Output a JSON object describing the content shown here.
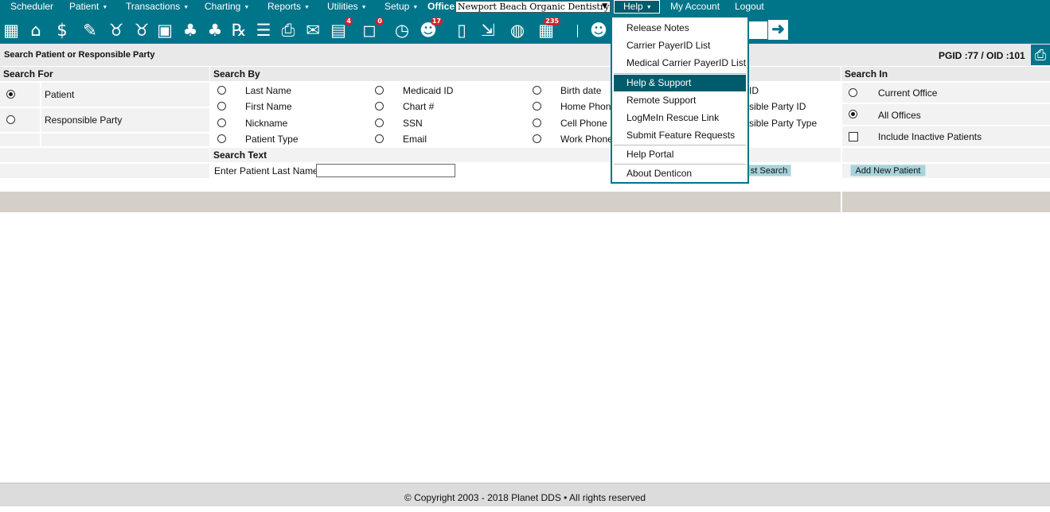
{
  "nav": {
    "items": [
      {
        "label": "Scheduler",
        "caret": ""
      },
      {
        "label": "Patient",
        "caret": "▼"
      },
      {
        "label": "Transactions",
        "caret": "▼"
      },
      {
        "label": "Charting",
        "caret": "▼"
      },
      {
        "label": "Reports",
        "caret": "▼"
      },
      {
        "label": "Utilities",
        "caret": "▼"
      },
      {
        "label": "Setup",
        "caret": "▼"
      }
    ],
    "office_label": "Office",
    "office_value": "Newport Beach Organic Dentistry",
    "help_label": "Help",
    "help_caret": "▼",
    "my_account": "My Account",
    "logout": "Logout"
  },
  "toolbar": {
    "badges": {
      "messages": "4",
      "chat": "0",
      "users": "17",
      "tasks": "235"
    }
  },
  "title": {
    "text": "Search Patient or Responsible Party",
    "ids": "PGID :77  /  OID :101"
  },
  "search_for": {
    "header": "Search For",
    "options": [
      "Patient",
      "Responsible Party"
    ],
    "selected": "Patient"
  },
  "search_by": {
    "header": "Search By",
    "col1": [
      "Last Name",
      "First Name",
      "Nickname",
      "Patient Type"
    ],
    "col2": [
      "Medicaid ID",
      "Chart #",
      "SSN",
      "Email"
    ],
    "col3": [
      "Birth date",
      "Home Phone",
      "Cell Phone",
      "Work Phone"
    ],
    "col4_partial": [
      "ID",
      "sible Party ID",
      "sible Party Type"
    ]
  },
  "search_text": {
    "header": "Search Text",
    "label": "Enter Patient Last Name:",
    "value": "",
    "last_search_partial": "st Search"
  },
  "search_in": {
    "header": "Search In",
    "current_office": "Current Office",
    "all_offices": "All Offices",
    "include_inactive": "Include Inactive Patients",
    "selected": "All Offices",
    "add_new_patient": "Add New Patient"
  },
  "help_menu": {
    "items": [
      "Release Notes",
      "Carrier PayerID List",
      "Medical Carrier PayerID List",
      "Help & Support",
      "Remote Support",
      "LogMeIn Rescue Link",
      "Submit Feature Requests",
      "Help Portal",
      "About Denticon"
    ],
    "highlighted": "Help & Support"
  },
  "footer": "© Copyright 2003 - 2018 Planet DDS • All rights reserved",
  "colors": {
    "brand": "#00758a",
    "highlight": "#005c6c",
    "badge": "#d2222d"
  }
}
